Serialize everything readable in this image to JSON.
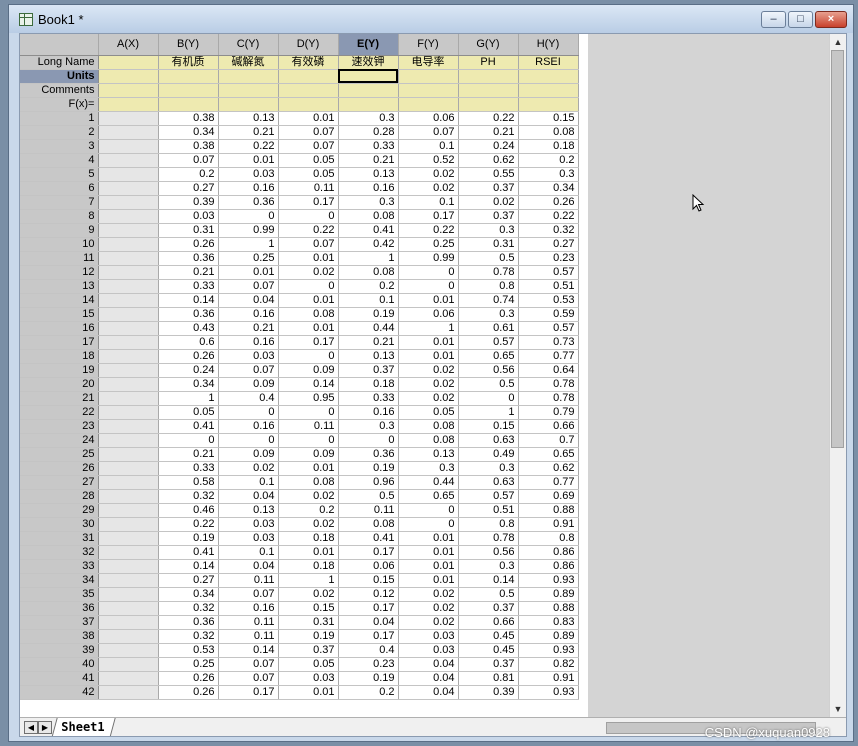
{
  "window": {
    "title": "Book1 *"
  },
  "controls": {
    "minimize": "–",
    "maximize": "□",
    "close": "×"
  },
  "columns": [
    "A(X)",
    "B(Y)",
    "C(Y)",
    "D(Y)",
    "E(Y)",
    "F(Y)",
    "G(Y)",
    "H(Y)"
  ],
  "selected_column_index": 4,
  "meta_rows": {
    "long_name_label": "Long Name",
    "units_label": "Units",
    "comments_label": "Comments",
    "fx_label": "F(x)=",
    "long_names": [
      "",
      "有机质",
      "碱解氮",
      "有效磷",
      "速效钾",
      "电导率",
      "PH",
      "RSEI"
    ]
  },
  "rows": [
    [
      1,
      "",
      "0.38",
      "0.13",
      "0.01",
      "0.3",
      "0.06",
      "0.22",
      "0.15"
    ],
    [
      2,
      "",
      "0.34",
      "0.21",
      "0.07",
      "0.28",
      "0.07",
      "0.21",
      "0.08"
    ],
    [
      3,
      "",
      "0.38",
      "0.22",
      "0.07",
      "0.33",
      "0.1",
      "0.24",
      "0.18"
    ],
    [
      4,
      "",
      "0.07",
      "0.01",
      "0.05",
      "0.21",
      "0.52",
      "0.62",
      "0.2"
    ],
    [
      5,
      "",
      "0.2",
      "0.03",
      "0.05",
      "0.13",
      "0.02",
      "0.55",
      "0.3"
    ],
    [
      6,
      "",
      "0.27",
      "0.16",
      "0.11",
      "0.16",
      "0.02",
      "0.37",
      "0.34"
    ],
    [
      7,
      "",
      "0.39",
      "0.36",
      "0.17",
      "0.3",
      "0.1",
      "0.02",
      "0.26"
    ],
    [
      8,
      "",
      "0.03",
      "0",
      "0",
      "0.08",
      "0.17",
      "0.37",
      "0.22"
    ],
    [
      9,
      "",
      "0.31",
      "0.99",
      "0.22",
      "0.41",
      "0.22",
      "0.3",
      "0.32"
    ],
    [
      10,
      "",
      "0.26",
      "1",
      "0.07",
      "0.42",
      "0.25",
      "0.31",
      "0.27"
    ],
    [
      11,
      "",
      "0.36",
      "0.25",
      "0.01",
      "1",
      "0.99",
      "0.5",
      "0.23"
    ],
    [
      12,
      "",
      "0.21",
      "0.01",
      "0.02",
      "0.08",
      "0",
      "0.78",
      "0.57"
    ],
    [
      13,
      "",
      "0.33",
      "0.07",
      "0",
      "0.2",
      "0",
      "0.8",
      "0.51"
    ],
    [
      14,
      "",
      "0.14",
      "0.04",
      "0.01",
      "0.1",
      "0.01",
      "0.74",
      "0.53"
    ],
    [
      15,
      "",
      "0.36",
      "0.16",
      "0.08",
      "0.19",
      "0.06",
      "0.3",
      "0.59"
    ],
    [
      16,
      "",
      "0.43",
      "0.21",
      "0.01",
      "0.44",
      "1",
      "0.61",
      "0.57"
    ],
    [
      17,
      "",
      "0.6",
      "0.16",
      "0.17",
      "0.21",
      "0.01",
      "0.57",
      "0.73"
    ],
    [
      18,
      "",
      "0.26",
      "0.03",
      "0",
      "0.13",
      "0.01",
      "0.65",
      "0.77"
    ],
    [
      19,
      "",
      "0.24",
      "0.07",
      "0.09",
      "0.37",
      "0.02",
      "0.56",
      "0.64"
    ],
    [
      20,
      "",
      "0.34",
      "0.09",
      "0.14",
      "0.18",
      "0.02",
      "0.5",
      "0.78"
    ],
    [
      21,
      "",
      "1",
      "0.4",
      "0.95",
      "0.33",
      "0.02",
      "0",
      "0.78"
    ],
    [
      22,
      "",
      "0.05",
      "0",
      "0",
      "0.16",
      "0.05",
      "1",
      "0.79"
    ],
    [
      23,
      "",
      "0.41",
      "0.16",
      "0.11",
      "0.3",
      "0.08",
      "0.15",
      "0.66"
    ],
    [
      24,
      "",
      "0",
      "0",
      "0",
      "0",
      "0.08",
      "0.63",
      "0.7"
    ],
    [
      25,
      "",
      "0.21",
      "0.09",
      "0.09",
      "0.36",
      "0.13",
      "0.49",
      "0.65"
    ],
    [
      26,
      "",
      "0.33",
      "0.02",
      "0.01",
      "0.19",
      "0.3",
      "0.3",
      "0.62"
    ],
    [
      27,
      "",
      "0.58",
      "0.1",
      "0.08",
      "0.96",
      "0.44",
      "0.63",
      "0.77"
    ],
    [
      28,
      "",
      "0.32",
      "0.04",
      "0.02",
      "0.5",
      "0.65",
      "0.57",
      "0.69"
    ],
    [
      29,
      "",
      "0.46",
      "0.13",
      "0.2",
      "0.11",
      "0",
      "0.51",
      "0.88"
    ],
    [
      30,
      "",
      "0.22",
      "0.03",
      "0.02",
      "0.08",
      "0",
      "0.8",
      "0.91"
    ],
    [
      31,
      "",
      "0.19",
      "0.03",
      "0.18",
      "0.41",
      "0.01",
      "0.78",
      "0.8"
    ],
    [
      32,
      "",
      "0.41",
      "0.1",
      "0.01",
      "0.17",
      "0.01",
      "0.56",
      "0.86"
    ],
    [
      33,
      "",
      "0.14",
      "0.04",
      "0.18",
      "0.06",
      "0.01",
      "0.3",
      "0.86"
    ],
    [
      34,
      "",
      "0.27",
      "0.11",
      "1",
      "0.15",
      "0.01",
      "0.14",
      "0.93"
    ],
    [
      35,
      "",
      "0.34",
      "0.07",
      "0.02",
      "0.12",
      "0.02",
      "0.5",
      "0.89"
    ],
    [
      36,
      "",
      "0.32",
      "0.16",
      "0.15",
      "0.17",
      "0.02",
      "0.37",
      "0.88"
    ],
    [
      37,
      "",
      "0.36",
      "0.11",
      "0.31",
      "0.04",
      "0.02",
      "0.66",
      "0.83"
    ],
    [
      38,
      "",
      "0.32",
      "0.11",
      "0.19",
      "0.17",
      "0.03",
      "0.45",
      "0.89"
    ],
    [
      39,
      "",
      "0.53",
      "0.14",
      "0.37",
      "0.4",
      "0.03",
      "0.45",
      "0.93"
    ],
    [
      40,
      "",
      "0.25",
      "0.07",
      "0.05",
      "0.23",
      "0.04",
      "0.37",
      "0.82"
    ],
    [
      41,
      "",
      "0.26",
      "0.07",
      "0.03",
      "0.19",
      "0.04",
      "0.81",
      "0.91"
    ],
    [
      42,
      "",
      "0.26",
      "0.17",
      "0.01",
      "0.2",
      "0.04",
      "0.39",
      "0.93"
    ]
  ],
  "sheet_tab": "Sheet1",
  "watermark": "CSDN @xuquan0928"
}
